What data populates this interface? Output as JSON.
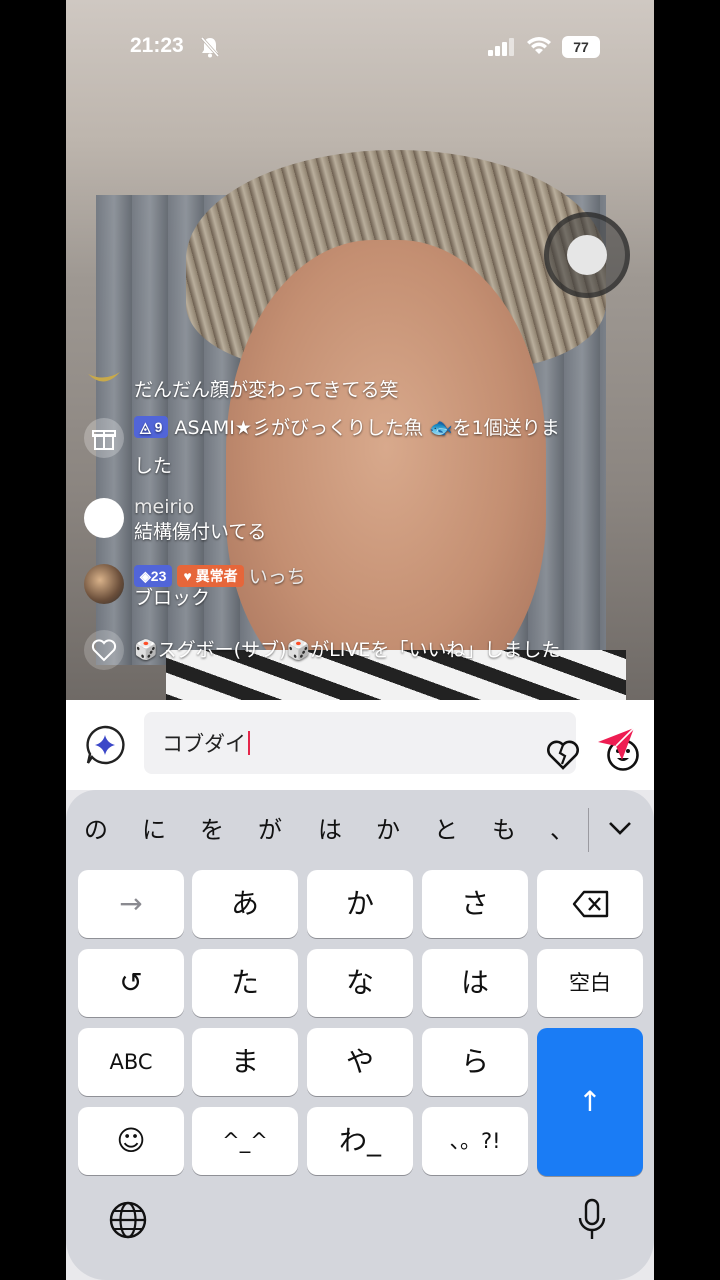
{
  "status_bar": {
    "time": "21:23",
    "battery": "77"
  },
  "comments": [
    {
      "type": "comment",
      "text": "だんだん顔が変わってきてる笑"
    },
    {
      "type": "gift",
      "badge": "9",
      "line1": "ASAMI★彡がびっくりした魚 🐟を1個送りま",
      "line2": "した"
    },
    {
      "type": "comment",
      "user": "meirio",
      "text": "結構傷付いてる"
    },
    {
      "type": "comment",
      "badge": "23",
      "badge2": "異常者",
      "user": "いっち",
      "text": "ブロック"
    },
    {
      "type": "like",
      "text": "🎲スグボー(サブ)🎲がLIVEを「いいね」しました"
    }
  ],
  "input": {
    "value": "コブダイ"
  },
  "keyboard": {
    "suggestions": [
      "の",
      "に",
      "を",
      "が",
      "は",
      "か",
      "と",
      "も",
      "、"
    ],
    "keys": {
      "arrow": "→",
      "a": "あ",
      "ka": "か",
      "sa": "さ",
      "undo": "↺",
      "ta": "た",
      "na": "な",
      "ha": "は",
      "space": "空白",
      "abc": "ABC",
      "ma": "ま",
      "ya": "や",
      "ra": "ら",
      "emoji": "☺",
      "kaomoji": "^_^",
      "wa": "わ_",
      "punct": "、。?!",
      "enter": "↑"
    }
  },
  "colors": {
    "send": "#ee1d52",
    "enter": "#1a7cf5",
    "caret": "#e5264a"
  }
}
